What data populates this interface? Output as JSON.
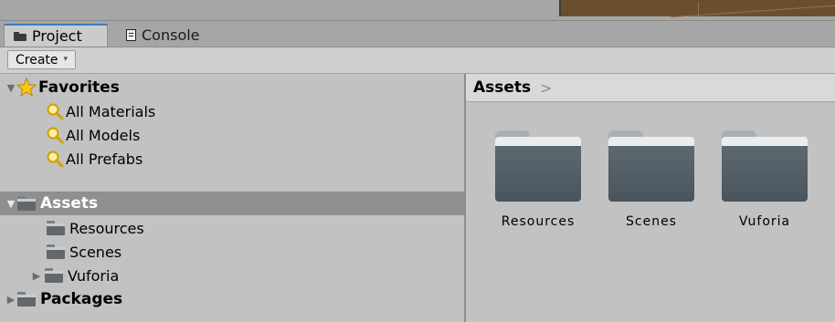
{
  "tabs": [
    {
      "label": "Project",
      "icon": "folder-icon",
      "active": true
    },
    {
      "label": "Console",
      "icon": "console-icon",
      "active": false
    }
  ],
  "toolbar": {
    "create_label": "Create",
    "create_caret": "▾"
  },
  "tree": {
    "favorites": {
      "label": "Favorites",
      "items": [
        "All Materials",
        "All Models",
        "All Prefabs"
      ]
    },
    "assets": {
      "label": "Assets",
      "selected": true,
      "children": [
        "Resources",
        "Scenes",
        "Vuforia"
      ]
    },
    "packages": {
      "label": "Packages"
    }
  },
  "breadcrumb": {
    "path": "Assets",
    "separator": ">"
  },
  "grid_items": [
    "Resources",
    "Scenes",
    "Vuforia"
  ],
  "colors": {
    "tab_accent": "#3c7fc0",
    "selected_row": "#8f8f8f",
    "panel_bg": "#c2c2c2",
    "favorite_star": "#f5c518",
    "folder": "#5f6b74"
  }
}
